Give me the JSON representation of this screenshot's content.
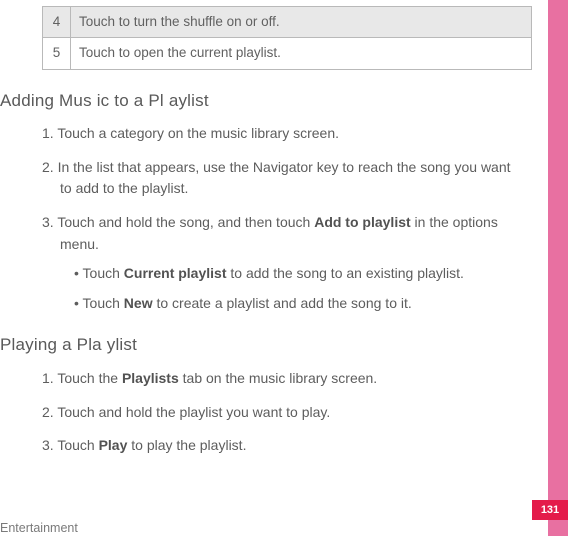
{
  "table": {
    "rows": [
      {
        "num": "4",
        "text": "Touch to turn the shuffle on or off."
      },
      {
        "num": "5",
        "text": "Touch to open the current playlist."
      }
    ]
  },
  "section1": {
    "title": "Adding Mus ic to  a Pl aylist",
    "steps": [
      {
        "num": "1.",
        "text": "Touch a category on the music library screen."
      },
      {
        "num": "2.",
        "text": "In the list that appears, use the Navigator key to reach the song you want to add to the playlist."
      },
      {
        "num": "3.",
        "pre": "Touch and hold the song, and then touch ",
        "bold": "Add to playlist",
        "post": " in the options menu."
      }
    ],
    "bullets": [
      {
        "pre": "Touch ",
        "bold": "Current playlist",
        "post": " to add the song to an existing playlist."
      },
      {
        "pre": "Touch ",
        "bold": "New",
        "post": " to create a playlist and add the song to it."
      }
    ]
  },
  "section2": {
    "title": "Playing a  Pla ylist",
    "steps": [
      {
        "num": "1.",
        "pre": "Touch the ",
        "bold": "Playlists",
        "post": " tab on the music library screen."
      },
      {
        "num": "2.",
        "text": "Touch and hold the playlist you want to play."
      },
      {
        "num": "3.",
        "pre": "Touch ",
        "bold": "Play",
        "post": " to play the playlist."
      }
    ]
  },
  "footer": "Entertainment",
  "pageNumber": "131"
}
